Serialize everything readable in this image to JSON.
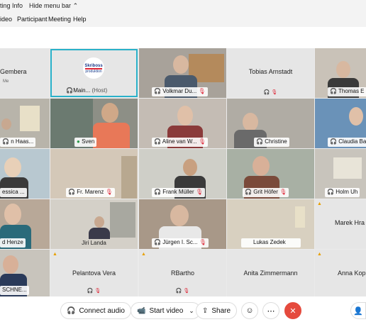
{
  "window": {
    "title_fragment": "ting Info",
    "hide_menu": "Hide menu bar",
    "hide_arrow": "⌃"
  },
  "menu": [
    "ideo",
    "Participant",
    "Meeting",
    "Help"
  ],
  "tiles": {
    "r1c1": {
      "name": "Gembera",
      "sub": "Me"
    },
    "r1c2": {
      "logo_line1": "Skriboss",
      "logo_line2": "produktion",
      "name": "Main...",
      "role": "(Host)"
    },
    "r1c3": {
      "name": "Volkmar Du..."
    },
    "r1c4": {
      "name": "Tobias Arnstadt"
    },
    "r1c5": {
      "name": "Thomas E"
    },
    "r2c1": {
      "name": "n Haas..."
    },
    "r2c2": {
      "name": "Sven"
    },
    "r2c3": {
      "name": "Aline van W..."
    },
    "r2c4": {
      "name": "Christine"
    },
    "r2c5": {
      "name": "Claudia Ba"
    },
    "r3c1": {
      "name": "essica ..."
    },
    "r3c2": {
      "name": "Fr. Marenz"
    },
    "r3c3": {
      "name": "Frank Müller"
    },
    "r3c4": {
      "name": "Grit Höfer"
    },
    "r3c5": {
      "name": "Holm Uh"
    },
    "r4c1": {
      "name": "d Henze"
    },
    "r4c2": {
      "name": "Jiri Landa"
    },
    "r4c3": {
      "name": "Jürgen I. Sc..."
    },
    "r4c4": {
      "name": "Lukas Zedek"
    },
    "r4c5": {
      "name": "Marek Hra"
    },
    "r5c1": {
      "name": "SCHNE..."
    },
    "r5c2": {
      "name": "Pelantova Vera"
    },
    "r5c3": {
      "name": "RBartho"
    },
    "r5c4": {
      "name": "Anita Zimmermann"
    },
    "r5c5": {
      "name": "Anna Kop"
    }
  },
  "toolbar": {
    "connect_audio": "Connect audio",
    "start_video": "Start video",
    "share": "Share"
  },
  "colors": {
    "accent_border": "#29b1c9",
    "leave": "#e54a3d",
    "warning": "#e8a000",
    "mute": "#d23"
  }
}
